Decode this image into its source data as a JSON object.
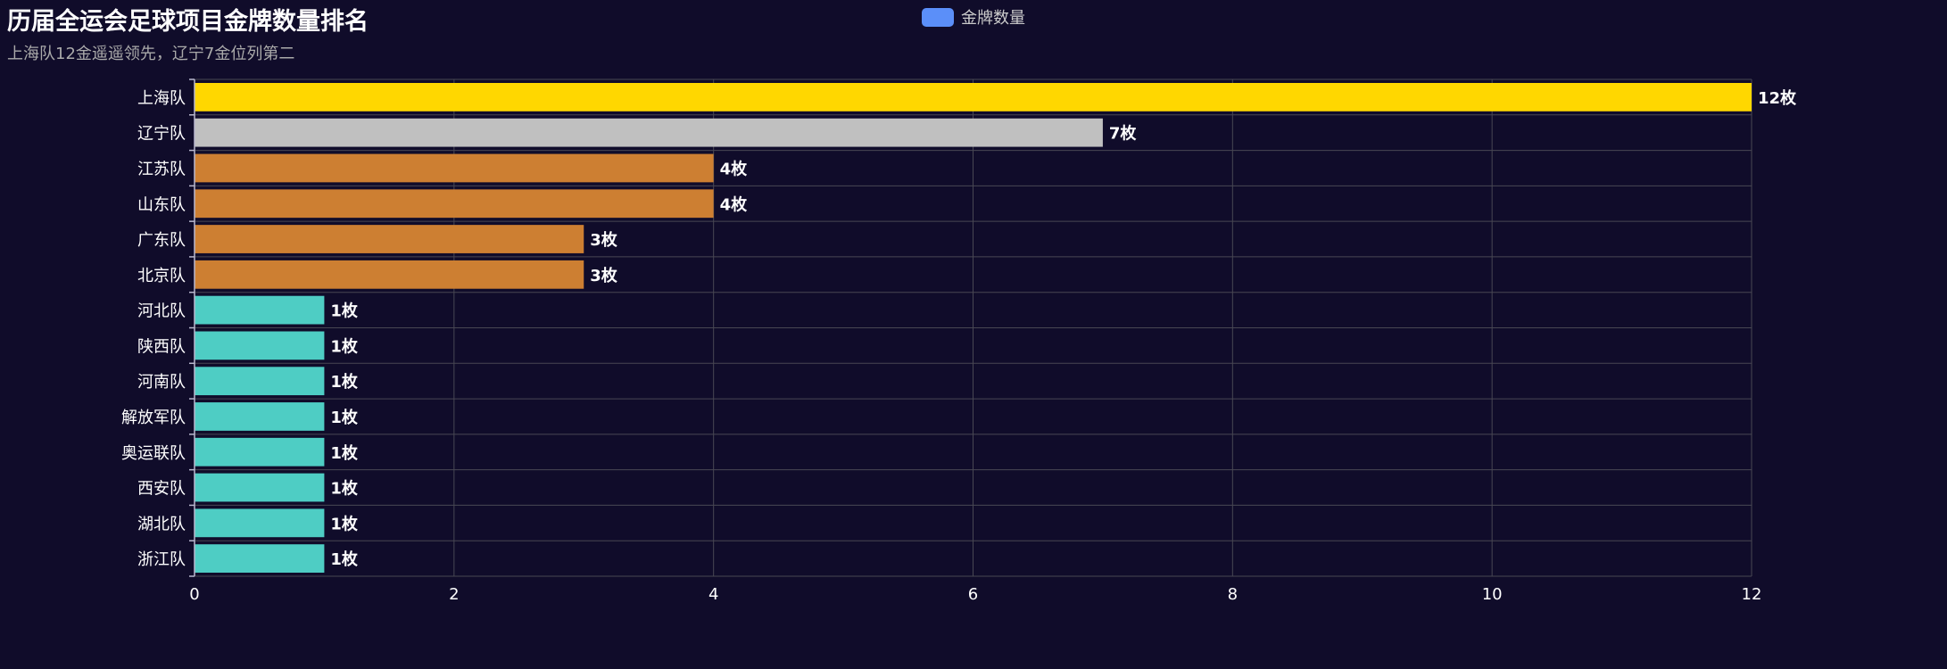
{
  "chart_data": {
    "type": "bar",
    "orientation": "horizontal",
    "title": "历届全运会足球项目金牌数量排名",
    "subtitle": "上海队12金遥遥领先，辽宁7金位列第二",
    "legend": {
      "label": "金牌数量",
      "color": "#5b8ff9",
      "position": "top-center"
    },
    "categories": [
      "上海队",
      "辽宁队",
      "江苏队",
      "山东队",
      "广东队",
      "北京队",
      "河北队",
      "陕西队",
      "河南队",
      "解放军队",
      "奥运联队",
      "西安队",
      "湖北队",
      "浙江队"
    ],
    "values": [
      12,
      7,
      4,
      4,
      3,
      3,
      1,
      1,
      1,
      1,
      1,
      1,
      1,
      1
    ],
    "bar_colors": [
      "#ffd700",
      "#c0c0c0",
      "#cd7f32",
      "#cd7f32",
      "#cd7f32",
      "#cd7f32",
      "#4ecdc4",
      "#4ecdc4",
      "#4ecdc4",
      "#4ecdc4",
      "#4ecdc4",
      "#4ecdc4",
      "#4ecdc4",
      "#4ecdc4"
    ],
    "label_suffix": "枚",
    "xlim": [
      0,
      12
    ],
    "x_ticks": [
      0,
      2,
      4,
      6,
      8,
      10,
      12
    ],
    "grid": true
  },
  "colors": {
    "background": "#100c2a",
    "grid": "#484753",
    "axis": "#b9b8ce"
  }
}
